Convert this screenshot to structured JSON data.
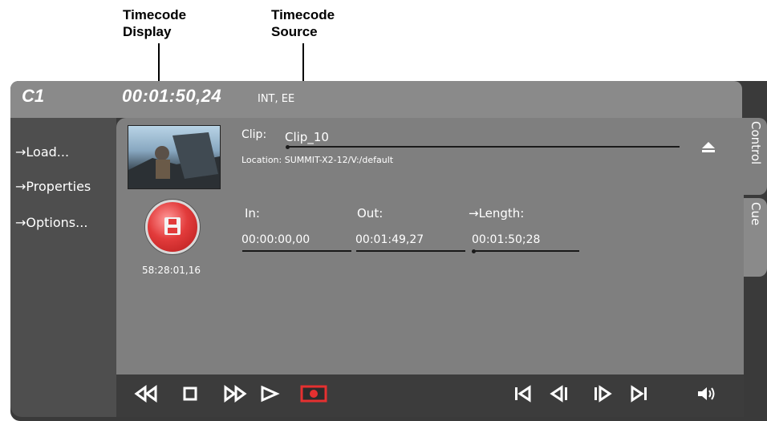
{
  "callouts": {
    "timecode_display": "Timecode\nDisplay",
    "timecode_source": "Timecode\nSource"
  },
  "header": {
    "channel": "C1",
    "timecode": "00:01:50,24",
    "timecode_source": "INT, EE"
  },
  "sidebar": {
    "items": [
      {
        "label": "→Load..."
      },
      {
        "label": "→Properties"
      },
      {
        "label": "→Options..."
      }
    ]
  },
  "clip": {
    "clip_label": "Clip:",
    "clip_name": "Clip_10",
    "location": "Location: SUMMIT-X2-12/V:/default"
  },
  "record": {
    "remaining": "58:28:01,16"
  },
  "fields": {
    "in_label": "In:",
    "in_value": "00:00:00,00",
    "out_label": "Out:",
    "out_value": "00:01:49,27",
    "length_label": "→Length:",
    "length_value": "00:01:50;28"
  },
  "tabs": {
    "control": "Control",
    "cue": "Cue"
  },
  "transport": {
    "buttons": [
      "rewind",
      "stop",
      "fast-forward",
      "play",
      "record",
      "go-to-start",
      "step-back",
      "step-forward",
      "go-to-end",
      "volume"
    ]
  },
  "colors": {
    "record_accent": "#e53030",
    "panel": "#7f7f7f",
    "frame": "#3a3a3a"
  }
}
